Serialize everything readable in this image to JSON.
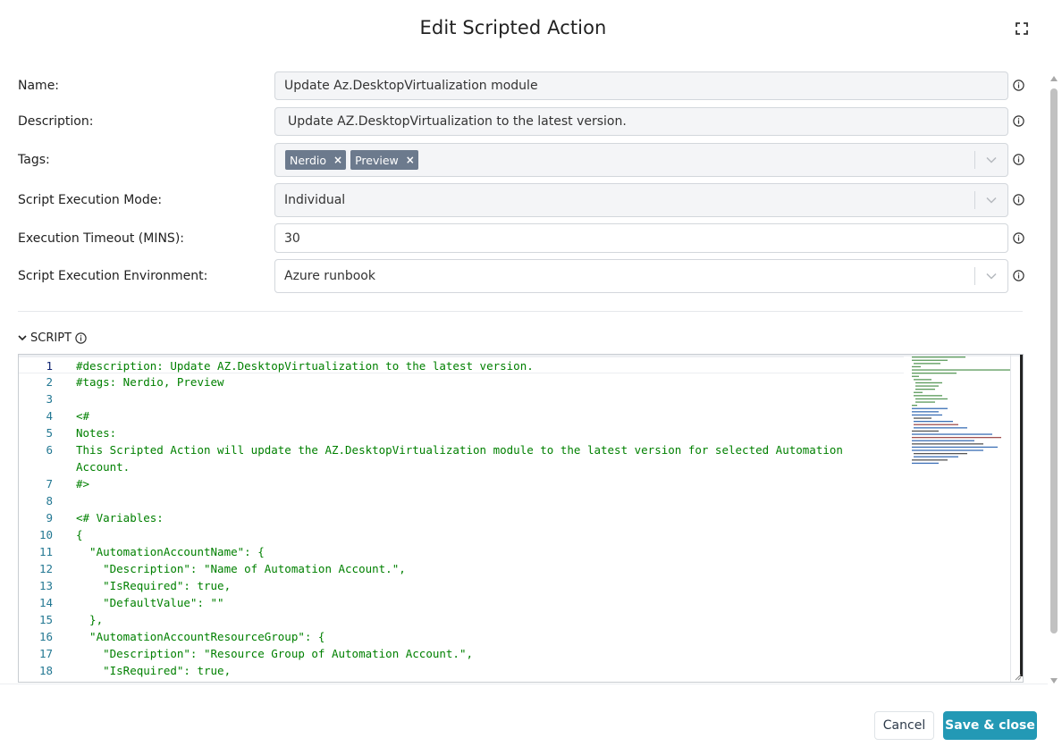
{
  "dialog": {
    "title": "Edit Scripted Action",
    "expand_icon": "expand-icon"
  },
  "form": {
    "name": {
      "label": "Name:",
      "value": "Update Az.DesktopVirtualization module"
    },
    "description": {
      "label": "Description:",
      "value": "Update AZ.DesktopVirtualization to the latest version."
    },
    "tags": {
      "label": "Tags:",
      "items": [
        "Nerdio",
        "Preview"
      ],
      "remove_glyph": "×"
    },
    "execution_mode": {
      "label": "Script Execution Mode:",
      "value": "Individual"
    },
    "timeout": {
      "label": "Execution Timeout (MINS):",
      "value": "30"
    },
    "environment": {
      "label": "Script Execution Environment:",
      "value": "Azure runbook"
    },
    "info_icon": "info-circle-icon"
  },
  "script": {
    "header": "SCRIPT",
    "lines": [
      {
        "n": "1",
        "text": "#description: Update AZ.DesktopVirtualization to the latest version."
      },
      {
        "n": "2",
        "text": "#tags: Nerdio, Preview"
      },
      {
        "n": "3",
        "text": ""
      },
      {
        "n": "4",
        "text": "<#"
      },
      {
        "n": "5",
        "text": "Notes:"
      },
      {
        "n": "6",
        "text": "This Scripted Action will update the AZ.DesktopVirtualization module to the latest version for selected Automation"
      },
      {
        "n": "",
        "text": "Account."
      },
      {
        "n": "7",
        "text": "#>"
      },
      {
        "n": "8",
        "text": ""
      },
      {
        "n": "9",
        "text": "<# Variables:"
      },
      {
        "n": "10",
        "text": "{"
      },
      {
        "n": "11",
        "text": "  \"AutomationAccountName\": {"
      },
      {
        "n": "12",
        "text": "    \"Description\": \"Name of Automation Account.\","
      },
      {
        "n": "13",
        "text": "    \"IsRequired\": true,"
      },
      {
        "n": "14",
        "text": "    \"DefaultValue\": \"\""
      },
      {
        "n": "15",
        "text": "  },"
      },
      {
        "n": "16",
        "text": "  \"AutomationAccountResourceGroup\": {"
      },
      {
        "n": "17",
        "text": "    \"Description\": \"Resource Group of Automation Account.\","
      },
      {
        "n": "18",
        "text": "    \"IsRequired\": true,"
      }
    ]
  },
  "footer": {
    "cancel_label": "Cancel",
    "save_label": "Save & close"
  },
  "colors": {
    "accent": "#2399b5",
    "tag_bg": "#6c7a8d",
    "code_green": "#008000",
    "line_number": "#237893"
  }
}
